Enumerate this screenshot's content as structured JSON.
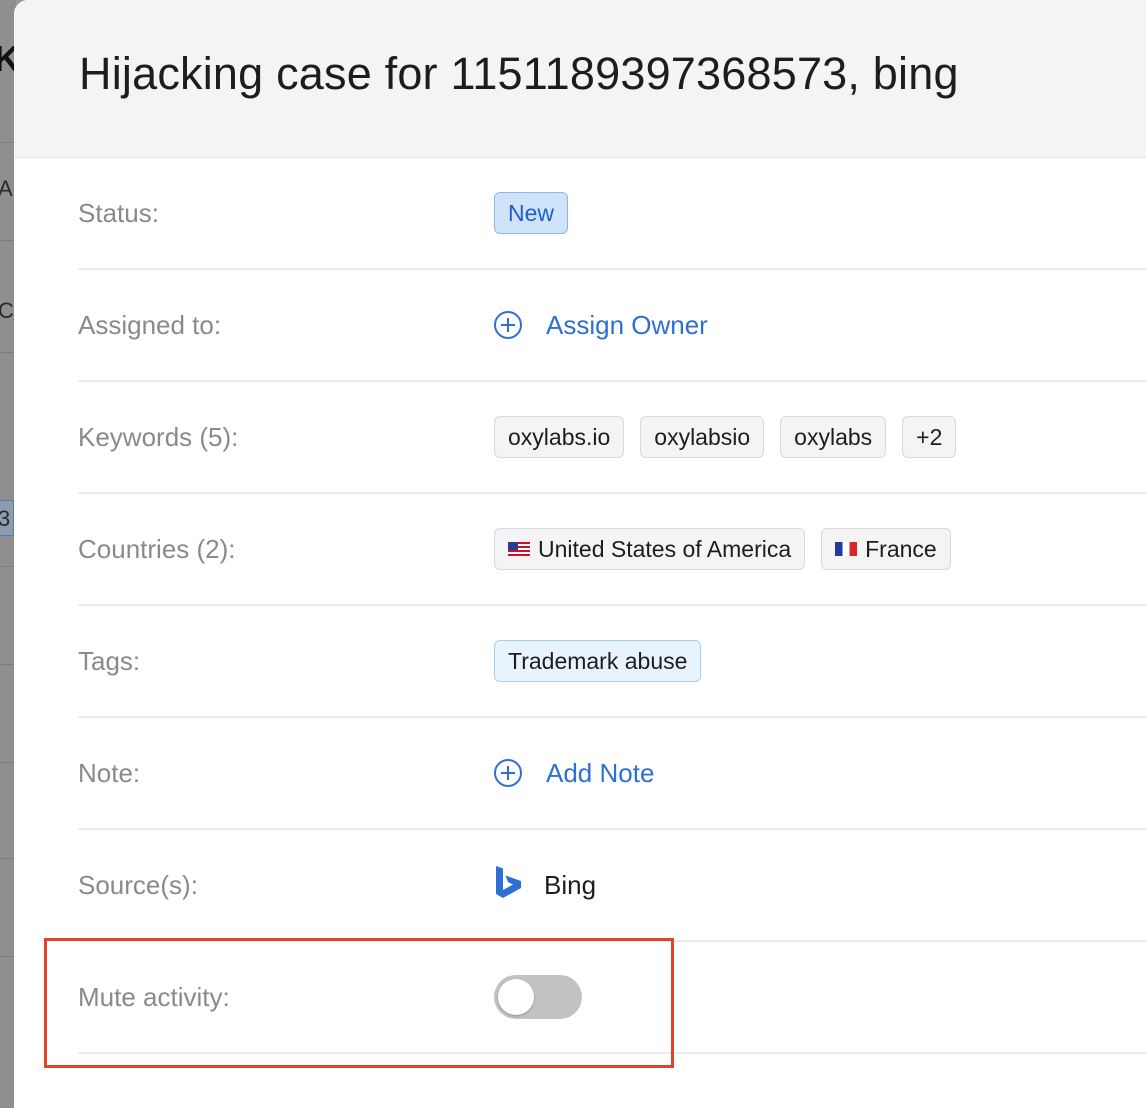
{
  "drawer": {
    "title": "Hijacking case for 1151189397368573, bing"
  },
  "fields": {
    "status": {
      "label": "Status:",
      "value": "New"
    },
    "assigned": {
      "label": "Assigned to:",
      "action": "Assign Owner"
    },
    "keywords": {
      "label": "Keywords (5):",
      "items": [
        "oxylabs.io",
        "oxylabsio",
        "oxylabs",
        "+2"
      ]
    },
    "countries": {
      "label": "Countries (2):",
      "items": [
        {
          "name": "United States of America",
          "flag": "flag-us-icon"
        },
        {
          "name": "France",
          "flag": "flag-fr-icon"
        }
      ]
    },
    "tags": {
      "label": "Tags:",
      "items": [
        "Trademark abuse"
      ]
    },
    "note": {
      "label": "Note:",
      "action": "Add Note"
    },
    "sources": {
      "label": "Source(s):",
      "value": "Bing",
      "icon": "bing-logo-icon"
    },
    "mute": {
      "label": "Mute activity:",
      "enabled": false
    }
  },
  "background_fragments": [
    "K",
    "A",
    "Co",
    "3"
  ],
  "colors": {
    "accent": "#2f6fd4",
    "status_badge_bg": "#cfe3fb",
    "highlight": "#e0452b",
    "toggle_off": "#c2c2c4"
  }
}
